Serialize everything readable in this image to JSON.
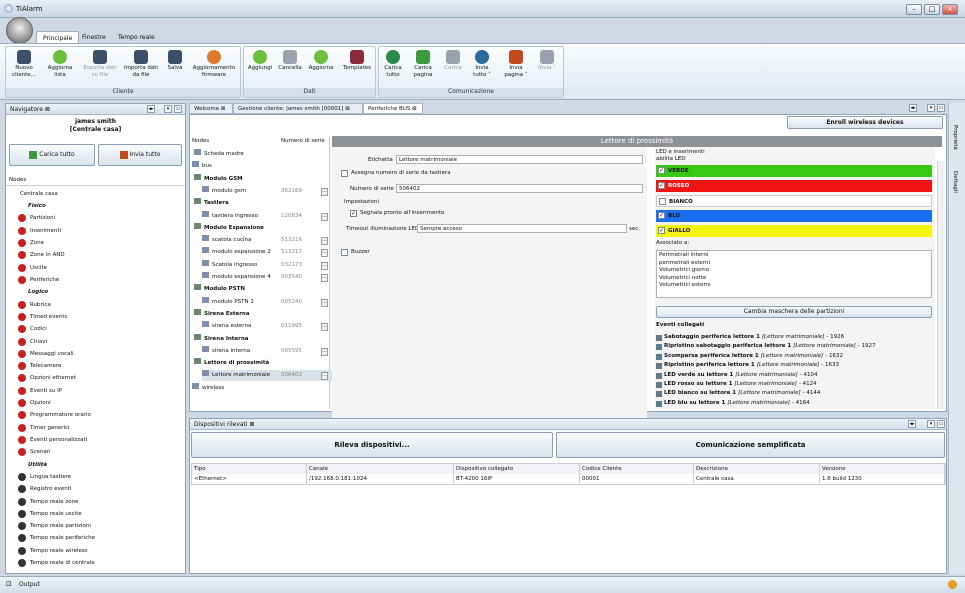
{
  "app": {
    "title": "TiAlarm"
  },
  "ribbon": {
    "tabs": [
      "Principale",
      "Finestre",
      "Tempo reale"
    ],
    "groups": [
      {
        "label": "Cliente",
        "buttons": [
          "Nuovo cliente...",
          "Aggiorna lista",
          "Esporta dati su file",
          "Importa dati da file",
          "Salva",
          "Aggiornamento firmware"
        ]
      },
      {
        "label": "Dati",
        "buttons": [
          "Aggiungi",
          "Cancella",
          "Aggiorna",
          "Templates"
        ]
      },
      {
        "label": "Comunicazione",
        "buttons": [
          "Carica tutto",
          "Carica pagina",
          "Carica",
          "Invia tutto",
          "Invia pagina",
          "Invia"
        ]
      }
    ]
  },
  "navigator": {
    "tab": "Navigatore",
    "user": "james smith",
    "site": "[Centrale casa]",
    "load_all": "Carica tutto",
    "send_all": "Invia tutto",
    "nodes_header": "Nodes",
    "root": "Centrale casa",
    "sections": {
      "fisico": "Fisico",
      "logico": "Logico",
      "utilita": "Utilità"
    },
    "fisico_items": [
      "Partizioni",
      "Inserimenti",
      "Zone",
      "Zone in AND",
      "Uscite",
      "Periferiche"
    ],
    "logico_items": [
      "Rubrica",
      "Timed events",
      "Codici",
      "Chiavi",
      "Messaggi vocali",
      "Telecamere",
      "Opzioni ethernet",
      "Eventi su IP",
      "Opzioni",
      "Programmatore orario",
      "Timer generici",
      "Eventi personalizzati",
      "Scenari"
    ],
    "utilita_items": [
      "Lingua tastiere",
      "Registro eventi",
      "Tempo reale zone",
      "Tempo reale uscite",
      "Tempo reale partizioni",
      "Tempo reale periferiche",
      "Tempo reale wireless",
      "Tempo reale di centrale"
    ]
  },
  "doc_tabs": [
    "Welcome",
    "Gestione cliente: james smith [00001]",
    "Periferiche BUS"
  ],
  "enroll_button": "Enroll wireless devices",
  "tree": {
    "col_nodes": "Nodes",
    "col_serial": "Numero di serie",
    "rows": [
      [
        "Scheda madre",
        ""
      ],
      [
        "bus",
        ""
      ],
      [
        "Modulo GSM",
        ""
      ],
      [
        "modulo gsm",
        "362169"
      ],
      [
        "Tastiera",
        ""
      ],
      [
        "tastiera ingresso",
        "120834"
      ],
      [
        "Modulo Espansione",
        ""
      ],
      [
        "scatola cucina",
        "513216"
      ],
      [
        "modulo espansione 2",
        "513217"
      ],
      [
        "Scatola ingresso",
        "032173"
      ],
      [
        "modulo espansione 4",
        "903540"
      ],
      [
        "Modulo PSTN",
        ""
      ],
      [
        "modulo PSTN 1",
        "005240"
      ],
      [
        "Sirena Esterna",
        ""
      ],
      [
        "sirena esterna",
        "011995"
      ],
      [
        "Sirena Interna",
        ""
      ],
      [
        "sirena interna",
        "005595"
      ],
      [
        "Lettore di prossimità",
        ""
      ],
      [
        "Lettore matrimoniale",
        "506402"
      ],
      [
        "wireless",
        ""
      ]
    ]
  },
  "form": {
    "header": "Lettore di prossimità",
    "etichetta_label": "Etichetta",
    "etichetta": "Lettore matrimoniale",
    "assign_serial": "Assegna numero di serie da tastiera",
    "serial_label": "Numero di serie",
    "serial": "506402",
    "impostazioni": "Impostazioni",
    "segnala": "Segnala pronto all'inserimento",
    "timeout_label": "Timeout illuminazione LED",
    "timeout": "Sempre acceso",
    "sec": "sec.",
    "buzzer": "Buzzer"
  },
  "leds": {
    "title": "LED e inserimenti",
    "abilita": "abilita LED",
    "items": [
      {
        "label": "VERDE",
        "color": "#39c914",
        "checked": true
      },
      {
        "label": "ROSSO",
        "color": "#f01414",
        "checked": true
      },
      {
        "label": "BIANCO",
        "color": "#ffffff",
        "checked": false
      },
      {
        "label": "BLU",
        "color": "#1a6ff0",
        "checked": true
      },
      {
        "label": "GIALLO",
        "color": "#f5f50a",
        "checked": true
      }
    ],
    "assoc_label": "Associato a:",
    "assoc": [
      "Perimetrali interni",
      "perimetrali esterni",
      "Volumetrici giorno",
      "Volumetrici notte",
      "Volumetrici esterni"
    ],
    "change_mask": "Cambia maschera delle partizioni",
    "events_title": "Eventi collegati",
    "events": [
      [
        "Sabotaggio periferica lettore 1",
        "[Lettore matrimoniale]",
        "- 1926"
      ],
      [
        "Ripristino sabotaggio periferica lettore 1",
        "[Lettore matrimoniale]",
        "- 1927"
      ],
      [
        "Scomparsa periferica lettore 1",
        "[Lettore matrimoniale]",
        "- 1632"
      ],
      [
        "Ripristino periferica lettore 1",
        "[Lettore matrimoniale]",
        "- 1633"
      ],
      [
        "LED verde su lettore 1",
        "[Lettore matrimoniale]",
        "- 4104"
      ],
      [
        "LED rosso su lettore 1",
        "[Lettore matrimoniale]",
        "- 4124"
      ],
      [
        "LED bianco su lettore 1",
        "[Lettore matrimoniale]",
        "- 4144"
      ],
      [
        "LED blu su lettore 1",
        "[Lettore matrimoniale]",
        "- 4164"
      ]
    ]
  },
  "devices": {
    "tab": "Dispositivi rilevati",
    "detect": "Rileva dispositivi...",
    "simple": "Comunicazione semplificata",
    "columns": [
      "Tipo",
      "Canale",
      "Dispositivo collegato",
      "Codice Cliente",
      "Descrizione",
      "Versione"
    ],
    "row": [
      "<Ethernet>",
      "/192.168.0.181:1024",
      "BT-4200 16IP",
      "00001",
      "Centrale casa",
      "1.6 build 1230"
    ]
  },
  "side": {
    "proprieta": "Proprietà",
    "dettagli": "Dettagli"
  },
  "status": {
    "output": "Output"
  }
}
